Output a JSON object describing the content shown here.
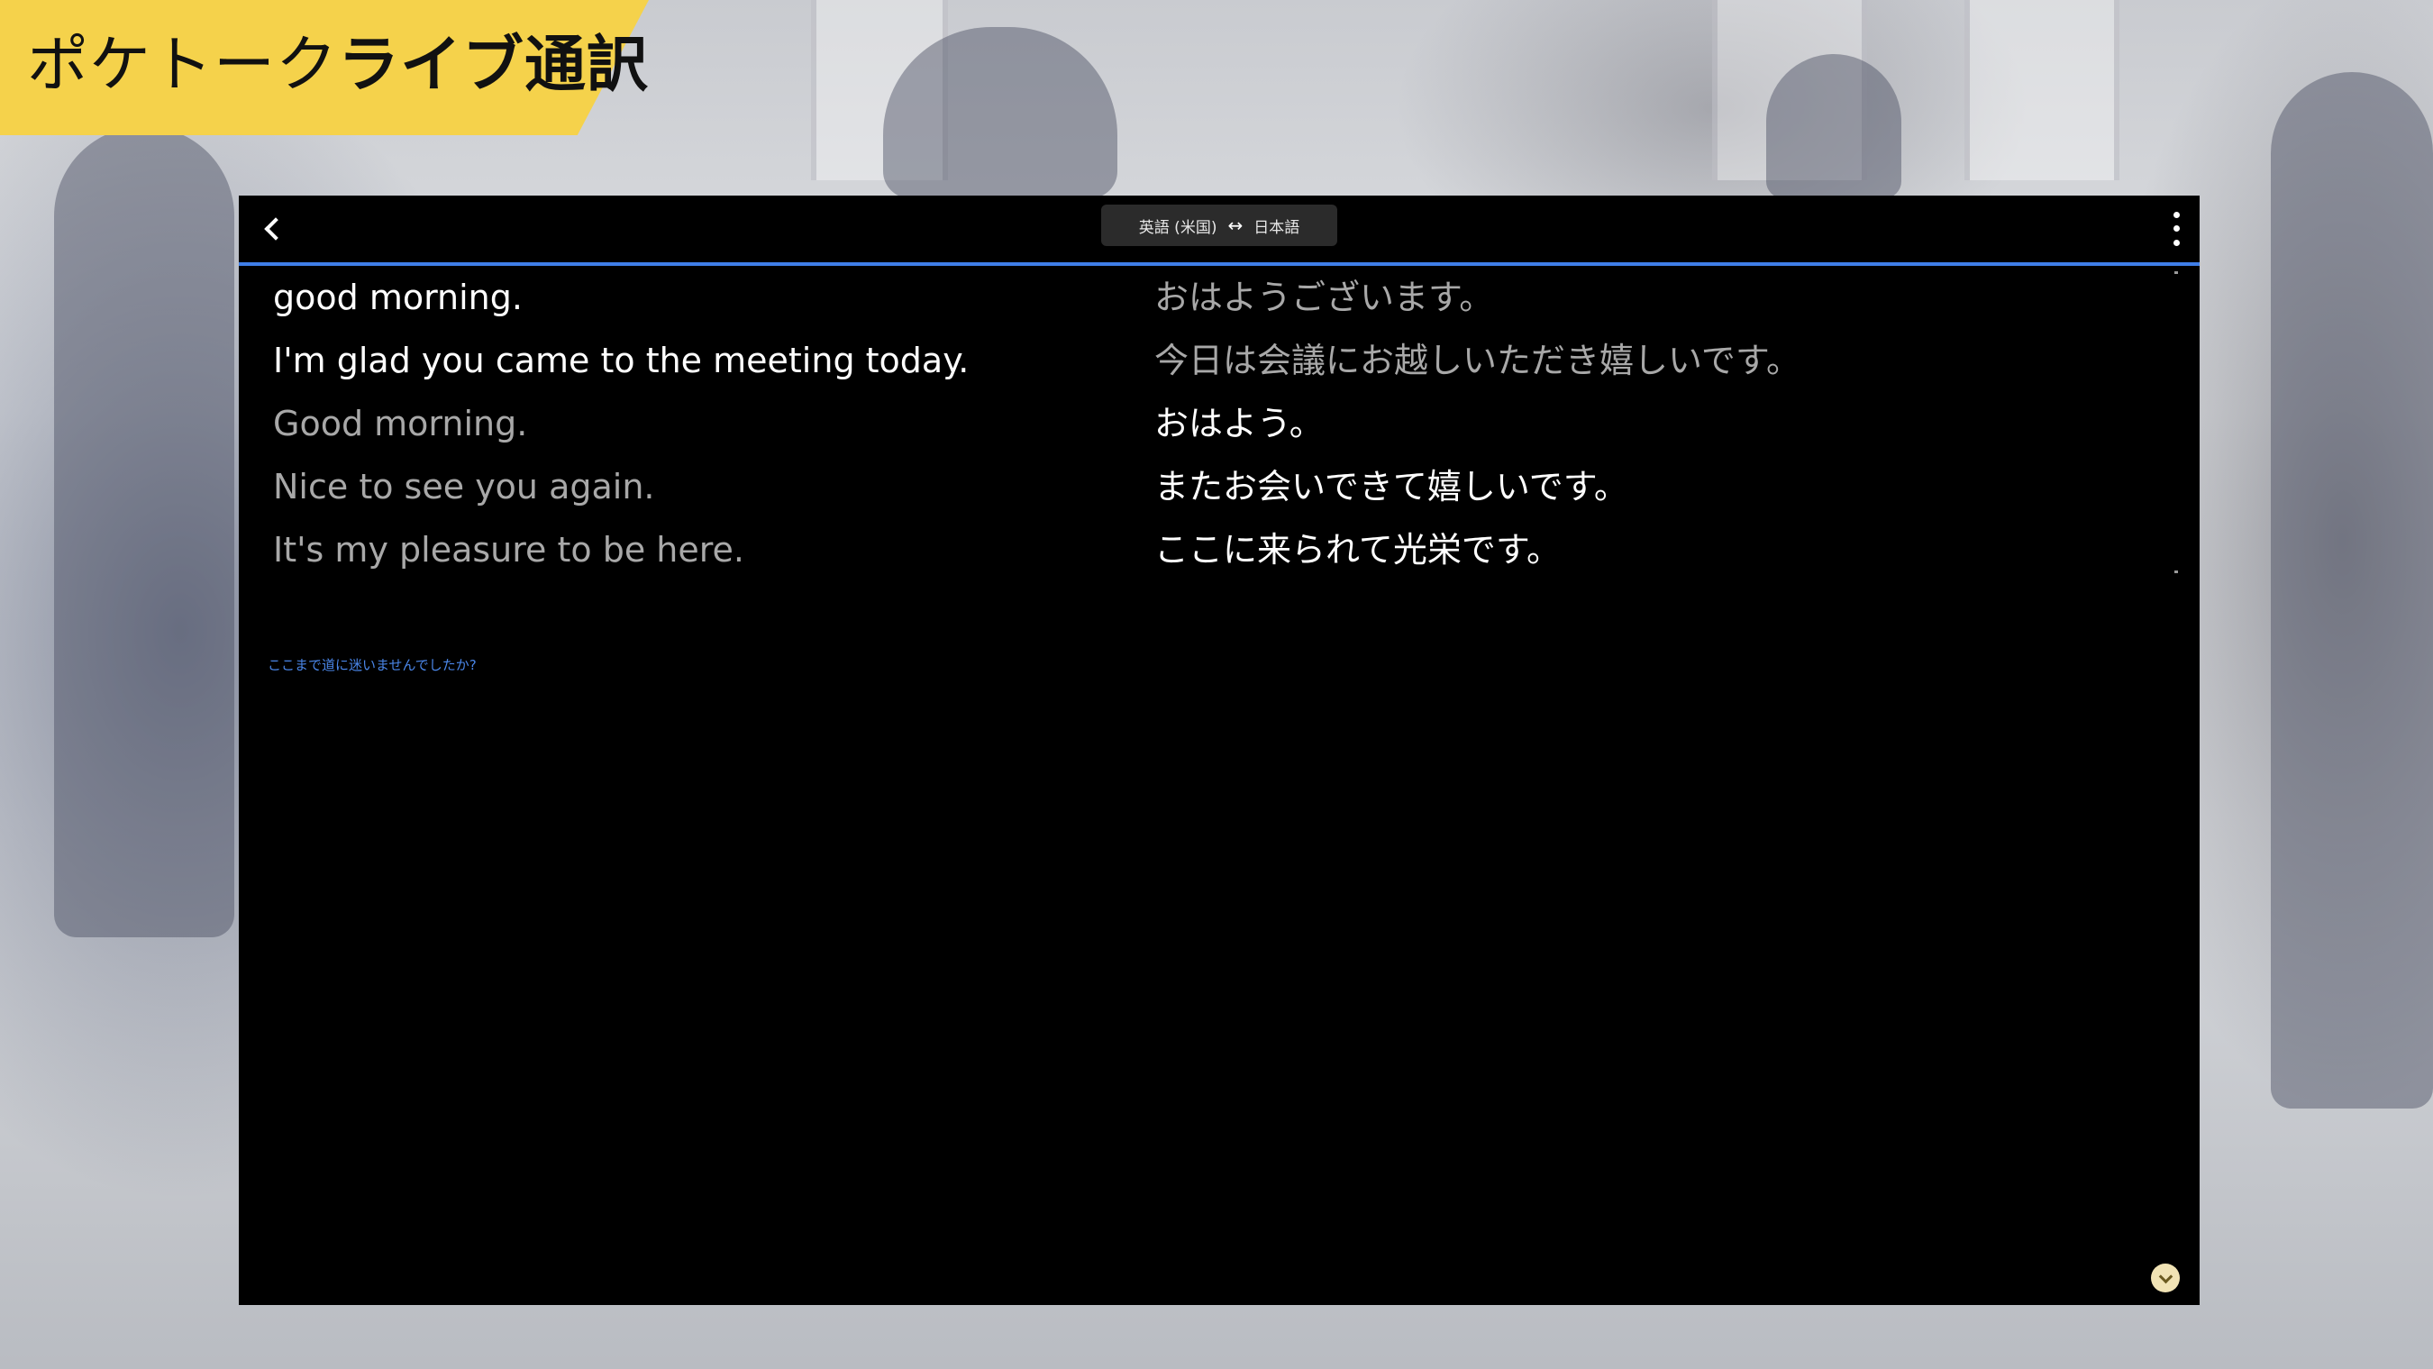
{
  "brand": {
    "name_light": "ポケトーク",
    "name_bold": "ライブ通訳",
    "color": "#f5d24b"
  },
  "header": {
    "back_icon": "chevron-left-icon",
    "language_pair": {
      "source": "英語 (米国)",
      "swap_symbol": "↔",
      "target": "日本語"
    },
    "menu_icon": "more-vertical-icon",
    "accent_color": "#3f7ee8"
  },
  "transcript": {
    "rows": [
      {
        "source": "good morning.",
        "source_state": "bright",
        "translation": "おはようございます。",
        "translation_state": "dim"
      },
      {
        "source": "I'm glad you came to the meeting today.",
        "source_state": "bright",
        "translation": "今日は会議にお越しいただき嬉しいです。",
        "translation_state": "dim"
      },
      {
        "source": "Good morning.",
        "source_state": "dim",
        "translation": "おはよう。",
        "translation_state": "bright"
      },
      {
        "source": "Nice to see you again.",
        "source_state": "dim",
        "translation": "またお会いできて嬉しいです。",
        "translation_state": "bright"
      },
      {
        "source": "It's my pleasure to be here.",
        "source_state": "dim",
        "translation": "ここに来られて光栄です。",
        "translation_state": "bright"
      }
    ],
    "pending": "ここまで道に迷いませんでしたか?"
  },
  "footer": {
    "scroll_button_icon": "chevron-down-icon"
  }
}
